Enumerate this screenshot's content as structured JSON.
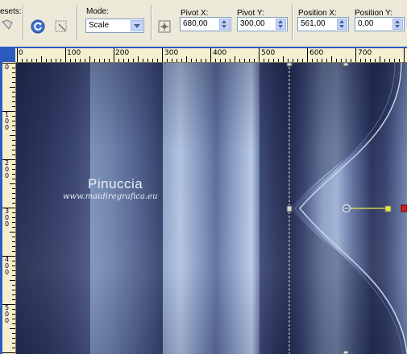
{
  "toolbar": {
    "presets_label": "esets:",
    "mode_label": "Mode:",
    "mode_value": "Scale",
    "pivot_x_label": "Pivot X:",
    "pivot_x_value": "680,00",
    "pivot_y_label": "Pivot Y:",
    "pivot_y_value": "300,00",
    "position_x_label": "Position X:",
    "position_x_value": "561,00",
    "position_y_label": "Position Y:",
    "position_y_value": "0,00"
  },
  "ruler_top": [
    "0",
    "100",
    "200",
    "300",
    "400",
    "500",
    "600",
    "700"
  ],
  "ruler_left": [
    "0",
    "100",
    "200",
    "300",
    "400",
    "500"
  ],
  "watermark": {
    "title": "Pinuccia",
    "url": "www.maidiregrafica.eu"
  },
  "colors": {
    "toolbar_bg": "#ece9d8",
    "frame_blue": "#2b5bbd",
    "ruler_bg": "#f4efd0",
    "dark_navy": "#1e2545",
    "light_steel": "#b5c6e2",
    "handle_yellow": "#e8e84a",
    "handle_red": "#d81818"
  }
}
